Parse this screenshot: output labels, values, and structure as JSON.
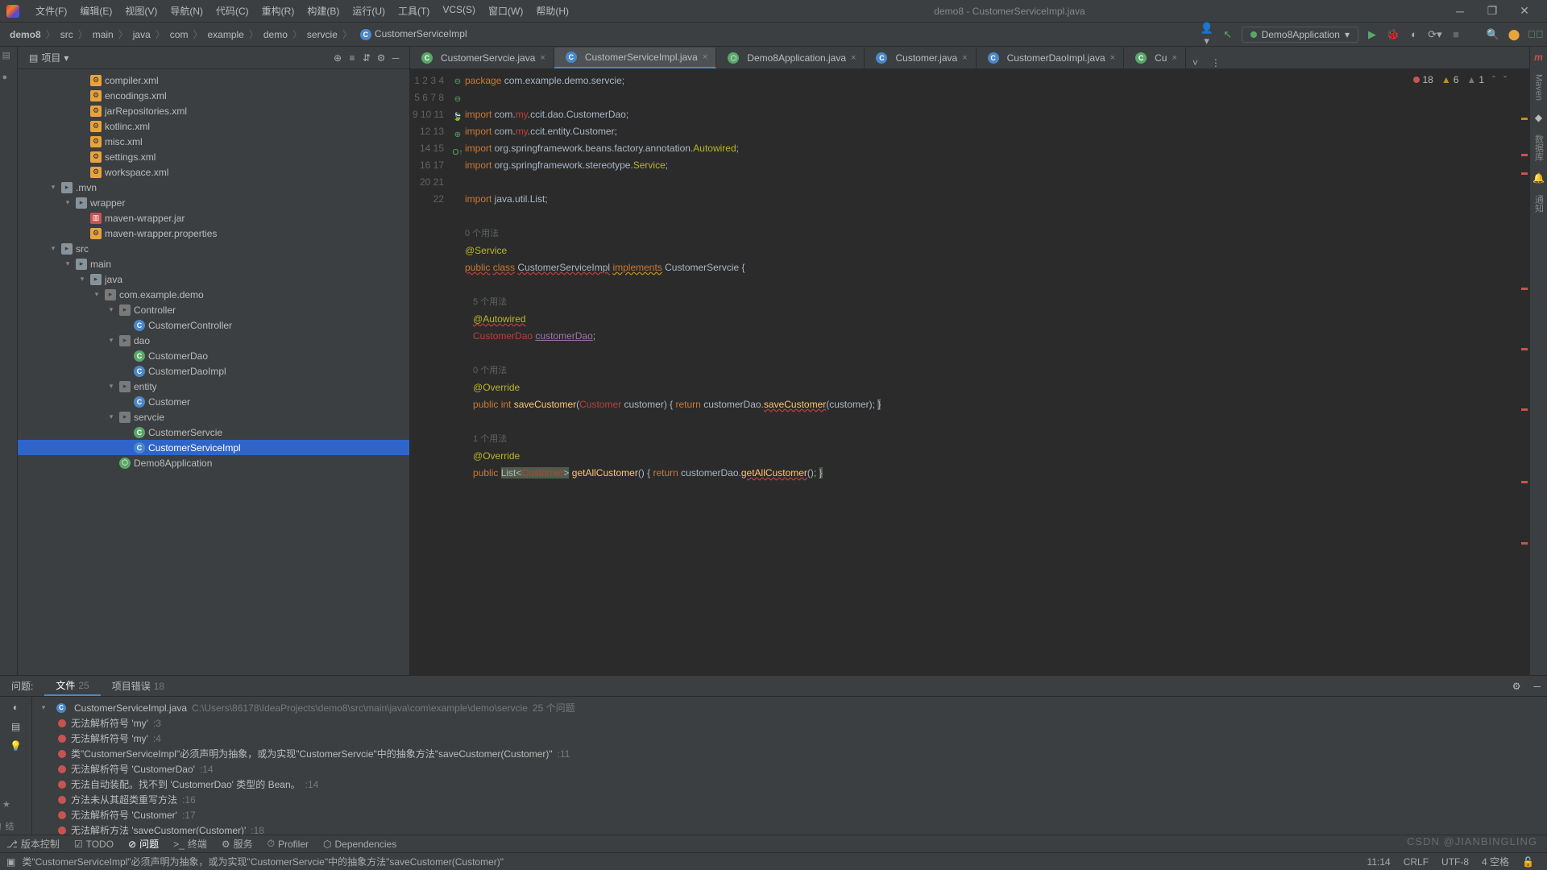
{
  "window": {
    "title": "demo8 - CustomerServiceImpl.java"
  },
  "menus": [
    "文件(F)",
    "编辑(E)",
    "视图(V)",
    "导航(N)",
    "代码(C)",
    "重构(R)",
    "构建(B)",
    "运行(U)",
    "工具(T)",
    "VCS(S)",
    "窗口(W)",
    "帮助(H)"
  ],
  "breadcrumbs": [
    "demo8",
    "src",
    "main",
    "java",
    "com",
    "example",
    "demo",
    "servcie",
    "CustomerServiceImpl"
  ],
  "run_config": "Demo8Application",
  "project": {
    "label": "项目",
    "nodes": [
      {
        "indent": 3,
        "icon": "xml",
        "label": "compiler.xml"
      },
      {
        "indent": 3,
        "icon": "xml",
        "label": "encodings.xml"
      },
      {
        "indent": 3,
        "icon": "xml",
        "label": "jarRepositories.xml"
      },
      {
        "indent": 3,
        "icon": "xml",
        "label": "kotlinc.xml"
      },
      {
        "indent": 3,
        "icon": "xml",
        "label": "misc.xml"
      },
      {
        "indent": 3,
        "icon": "xml",
        "label": "settings.xml"
      },
      {
        "indent": 3,
        "icon": "xml",
        "label": "workspace.xml"
      },
      {
        "indent": 1,
        "tw": "▾",
        "icon": "folder",
        "label": ".mvn"
      },
      {
        "indent": 2,
        "tw": "▾",
        "icon": "folder",
        "label": "wrapper"
      },
      {
        "indent": 3,
        "icon": "jar",
        "label": "maven-wrapper.jar"
      },
      {
        "indent": 3,
        "icon": "xml",
        "label": "maven-wrapper.properties"
      },
      {
        "indent": 1,
        "tw": "▾",
        "icon": "folder",
        "label": "src"
      },
      {
        "indent": 2,
        "tw": "▾",
        "icon": "folder",
        "label": "main"
      },
      {
        "indent": 3,
        "tw": "▾",
        "icon": "folder",
        "label": "java"
      },
      {
        "indent": 4,
        "tw": "▾",
        "icon": "pkg",
        "label": "com.example.demo"
      },
      {
        "indent": 5,
        "tw": "▾",
        "icon": "pkg",
        "label": "Controller"
      },
      {
        "indent": 6,
        "icon": "cls",
        "label": "CustomerController"
      },
      {
        "indent": 5,
        "tw": "▾",
        "icon": "pkg",
        "label": "dao"
      },
      {
        "indent": 6,
        "icon": "cls g",
        "label": "CustomerDao"
      },
      {
        "indent": 6,
        "icon": "cls",
        "label": "CustomerDaoImpl"
      },
      {
        "indent": 5,
        "tw": "▾",
        "icon": "pkg",
        "label": "entity"
      },
      {
        "indent": 6,
        "icon": "cls",
        "label": "Customer"
      },
      {
        "indent": 5,
        "tw": "▾",
        "icon": "pkg",
        "label": "servcie"
      },
      {
        "indent": 6,
        "icon": "cls g",
        "label": "CustomerServcie"
      },
      {
        "indent": 6,
        "icon": "cls",
        "label": "CustomerServiceImpl",
        "selected": true
      },
      {
        "indent": 5,
        "icon": "sb",
        "label": "Demo8Application"
      }
    ]
  },
  "tabs": [
    {
      "icon": "cls g",
      "label": "CustomerServcie.java"
    },
    {
      "icon": "cls",
      "label": "CustomerServiceImpl.java",
      "active": true
    },
    {
      "icon": "sb",
      "label": "Demo8Application.java"
    },
    {
      "icon": "cls",
      "label": "Customer.java"
    },
    {
      "icon": "cls",
      "label": "CustomerDaoImpl.java"
    },
    {
      "icon": "cls g",
      "label": "Cu"
    }
  ],
  "inspections": {
    "errors": "18",
    "warnings": "6",
    "weak": "1"
  },
  "code_lines": [
    {
      "n": 1,
      "html": "<span class='kw'>package</span> com.example.demo.servcie;"
    },
    {
      "n": 2,
      "html": ""
    },
    {
      "n": 3,
      "html": "<span class='kw'>import</span> com.<span class='err'>my</span>.ccit.dao.CustomerDao;",
      "fold": "⊖"
    },
    {
      "n": 4,
      "html": "<span class='kw'>import</span> com.<span class='err'>my</span>.ccit.entity.Customer;"
    },
    {
      "n": 5,
      "html": "<span class='kw'>import</span> org.springframework.beans.factory.annotation.<span class='ann'>Autowired</span>;"
    },
    {
      "n": 6,
      "html": "<span class='kw'>import</span> org.springframework.stereotype.<span class='ann'>Service</span>;"
    },
    {
      "n": 7,
      "html": ""
    },
    {
      "n": 8,
      "html": "<span class='kw'>import</span> java.util.List;",
      "fold": "⊖"
    },
    {
      "n": 9,
      "html": ""
    },
    {
      "n": "",
      "html": "<span class='hint'>0 个用法</span>"
    },
    {
      "n": 10,
      "html": "<span class='ann'>@Service</span>"
    },
    {
      "n": 11,
      "html": "<span class='kw err-u'>public</span> <span class='kw err-u'>class</span> <span class='err-u'>CustomerServiceImpl</span> <span class='kw warn-u'>implements</span> <span class='cls-n'>CustomerServcie</span> {",
      "fold": "🍃"
    },
    {
      "n": 12,
      "html": ""
    },
    {
      "n": "",
      "html": "   <span class='hint'>5 个用法</span>"
    },
    {
      "n": 13,
      "html": "   <span class='ann err-u'>@Autowired</span>"
    },
    {
      "n": 14,
      "html": "   <span class='err'>CustomerDao</span> <span class='field'>customerDao</span>;"
    },
    {
      "n": 15,
      "html": ""
    },
    {
      "n": "",
      "html": "   <span class='hint'>0 个用法</span>"
    },
    {
      "n": 16,
      "html": "   <span class='ann'>@Override</span>"
    },
    {
      "n": 17,
      "html": "   <span class='kw'>public</span> <span class='kw'>int</span> <span class='fn'>saveCustomer</span>(<span class='err'>Customer</span> customer) { <span class='kw'>return</span> customerDao.<span class='fn err-u'>saveCustomer</span>(customer); <span class='ov-bg'>}</span>",
      "fold": "⊕"
    },
    {
      "n": 20,
      "html": ""
    },
    {
      "n": "",
      "html": "   <span class='hint'>1 个用法</span>"
    },
    {
      "n": 21,
      "html": "   <span class='ann'>@Override</span>"
    },
    {
      "n": 22,
      "html": "   <span class='kw'>public</span> <span class='ov-bg'>List&lt;<span class='err'>Customer</span>&gt;</span> <span class='fn'>getAllCustomer</span>() { <span class='kw'>return</span> customerDao.<span class='fn err-u'>getAllCustomer</span>(); <span class='ov-bg'>}</span>",
      "fold": "O↑"
    }
  ],
  "problems": {
    "tabs": [
      {
        "label": "问题:"
      },
      {
        "label": "文件",
        "count": "25",
        "active": true
      },
      {
        "label": "项目错误",
        "count": "18"
      }
    ],
    "file": "CustomerServiceImpl.java",
    "file_path": "C:\\Users\\86178\\IdeaProjects\\demo8\\src\\main\\java\\com\\example\\demo\\servcie",
    "file_count": "25 个问题",
    "items": [
      {
        "msg": "无法解析符号 'my'",
        "loc": ":3"
      },
      {
        "msg": "无法解析符号 'my'",
        "loc": ":4"
      },
      {
        "msg": "类\"CustomerServiceImpl\"必须声明为抽象，或为实现\"CustomerServcie\"中的抽象方法\"saveCustomer(Customer)\"",
        "loc": ":11"
      },
      {
        "msg": "无法解析符号 'CustomerDao'",
        "loc": ":14"
      },
      {
        "msg": "无法自动装配。找不到 'CustomerDao' 类型的 Bean。",
        "loc": ":14"
      },
      {
        "msg": "方法未从其超类重写方法",
        "loc": ":16"
      },
      {
        "msg": "无法解析符号 'Customer'",
        "loc": ":17"
      },
      {
        "msg": "无法解析方法 'saveCustomer(Customer)'",
        "loc": ":18"
      }
    ]
  },
  "bottom_tools": [
    {
      "icon": "⎇",
      "label": "版本控制"
    },
    {
      "icon": "☑",
      "label": "TODO"
    },
    {
      "icon": "⊘",
      "label": "问题",
      "active": true
    },
    {
      "icon": ">_",
      "label": "终端"
    },
    {
      "icon": "⚙",
      "label": "服务"
    },
    {
      "icon": "⏱",
      "label": "Profiler"
    },
    {
      "icon": "⬡",
      "label": "Dependencies"
    }
  ],
  "status": {
    "icon_msg": "类\"CustomerServiceImpl\"必须声明为抽象，或为实现\"CustomerServcie\"中的抽象方法\"saveCustomer(Customer)\"",
    "pos": "11:14",
    "enc": "CRLF",
    "charset": "UTF-8",
    "indent": "4 空格",
    "lock": "🔓"
  },
  "watermark": "CSDN @JIANBINGLING"
}
